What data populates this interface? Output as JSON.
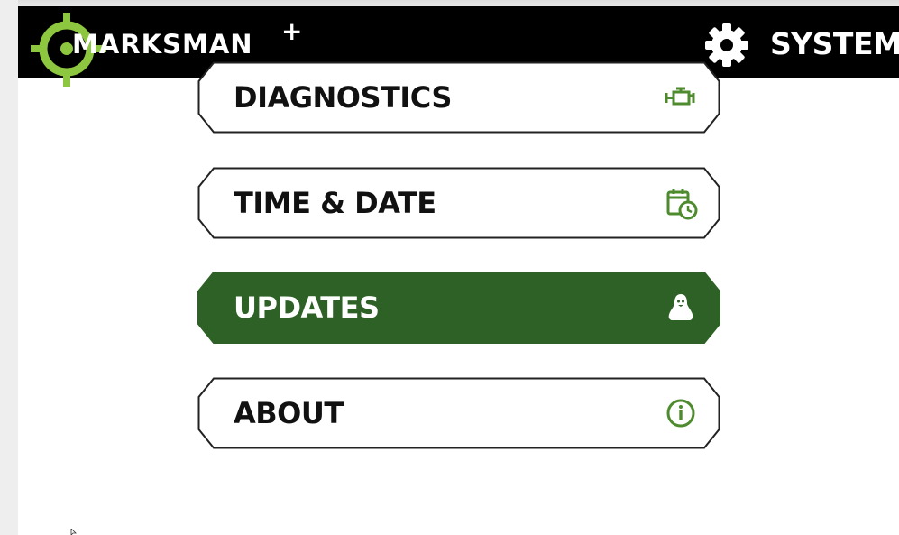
{
  "app": {
    "brand": "MARKSMAN",
    "brand_suffix": "+",
    "page_title": "SYSTEM",
    "header_icon": "gear-icon"
  },
  "colors": {
    "header_bg": "#000000",
    "logo_green": "#8dc63f",
    "accent_green": "#2e6126",
    "icon_green": "#4e8a2e",
    "border": "#222222"
  },
  "menu": {
    "items": [
      {
        "label": "DIAGNOSTICS",
        "icon": "engine-icon",
        "active": false
      },
      {
        "label": "TIME & DATE",
        "icon": "calendar-clock-icon",
        "active": false
      },
      {
        "label": "UPDATES",
        "icon": "linux-penguin-icon",
        "active": true
      },
      {
        "label": "ABOUT",
        "icon": "info-icon",
        "active": false
      }
    ]
  }
}
